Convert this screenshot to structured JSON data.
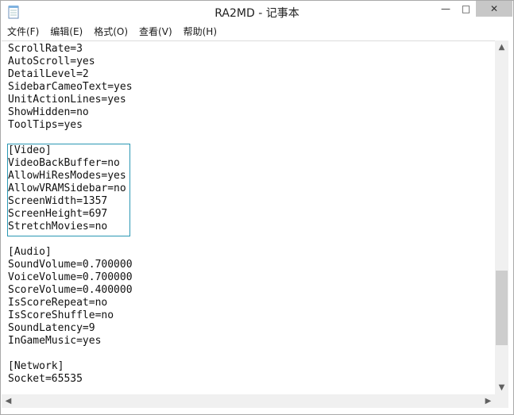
{
  "window": {
    "title": "RA2MD - 记事本",
    "minimize_glyph": "—",
    "maximize_glyph": "□",
    "close_glyph": "✕",
    "app_icon": "notepad-icon"
  },
  "menu": {
    "items": [
      "文件(F)",
      "编辑(E)",
      "格式(O)",
      "查看(V)",
      "帮助(H)"
    ]
  },
  "document": {
    "lines": [
      "ScrollRate=3",
      "AutoScroll=yes",
      "DetailLevel=2",
      "SidebarCameoText=yes",
      "UnitActionLines=yes",
      "ShowHidden=no",
      "ToolTips=yes",
      "",
      "[Video]",
      "VideoBackBuffer=no",
      "AllowHiResModes=yes",
      "AllowVRAMSidebar=no",
      "ScreenWidth=1357",
      "ScreenHeight=697",
      "StretchMovies=no",
      "",
      "[Audio]",
      "SoundVolume=0.700000",
      "VoiceVolume=0.700000",
      "ScoreVolume=0.400000",
      "IsScoreRepeat=no",
      "IsScoreShuffle=no",
      "SoundLatency=9",
      "InGameMusic=yes",
      "",
      "[Network]",
      "Socket=65535"
    ],
    "highlighted_section": "[Video]"
  },
  "scrollbars": {
    "up_arrow": "▲",
    "down_arrow": "▼",
    "left_arrow": "◀",
    "right_arrow": "▶"
  },
  "colors": {
    "selection_border": "#2a97b3",
    "scroll_track": "#f0f0f0",
    "scroll_thumb": "#cdcdcd"
  }
}
